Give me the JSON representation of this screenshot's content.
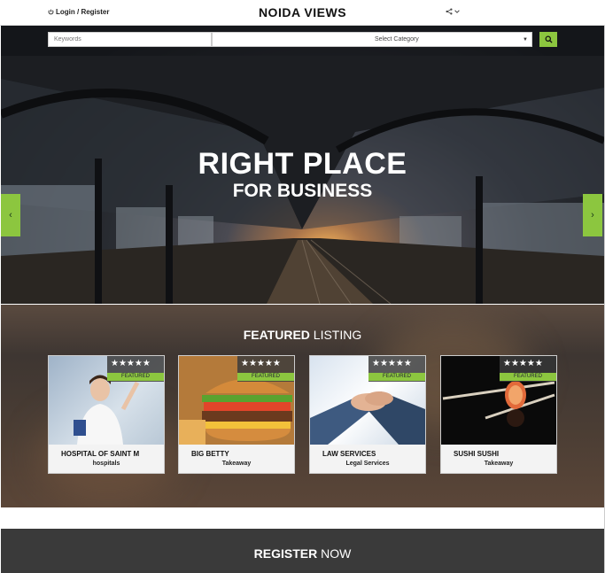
{
  "header": {
    "login_label": "Login / Register",
    "brand": "NOIDA VIEWS",
    "share_icon": "share-icon"
  },
  "search": {
    "keywords_placeholder": "Keywords",
    "category_value": "Select Category",
    "search_icon": "search-icon"
  },
  "hero": {
    "line1": "RIGHT PLACE",
    "line2": "FOR BUSINESS",
    "prev": "‹",
    "next": "›"
  },
  "featured": {
    "title_bold": "FEATURED",
    "title_rest": " LISTING",
    "cards": [
      {
        "name": "HOSPITAL OF SAINT M",
        "category": "hospitals",
        "stars": "★★★★★",
        "badge": "FEATURED"
      },
      {
        "name": "BIG BETTY",
        "category": "Takeaway",
        "stars": "★★★★★",
        "badge": "FEATURED"
      },
      {
        "name": "LAW SERVICES",
        "category": "Legal Services",
        "stars": "★★★★★",
        "badge": "FEATURED"
      },
      {
        "name": "SUSHI SUSHI",
        "category": "Takeaway",
        "stars": "★★★★★",
        "badge": "FEATURED"
      }
    ]
  },
  "register": {
    "bold": "REGISTER",
    "rest": " NOW"
  },
  "colors": {
    "accent": "#8cc63f",
    "dark": "#3a3a3a"
  }
}
